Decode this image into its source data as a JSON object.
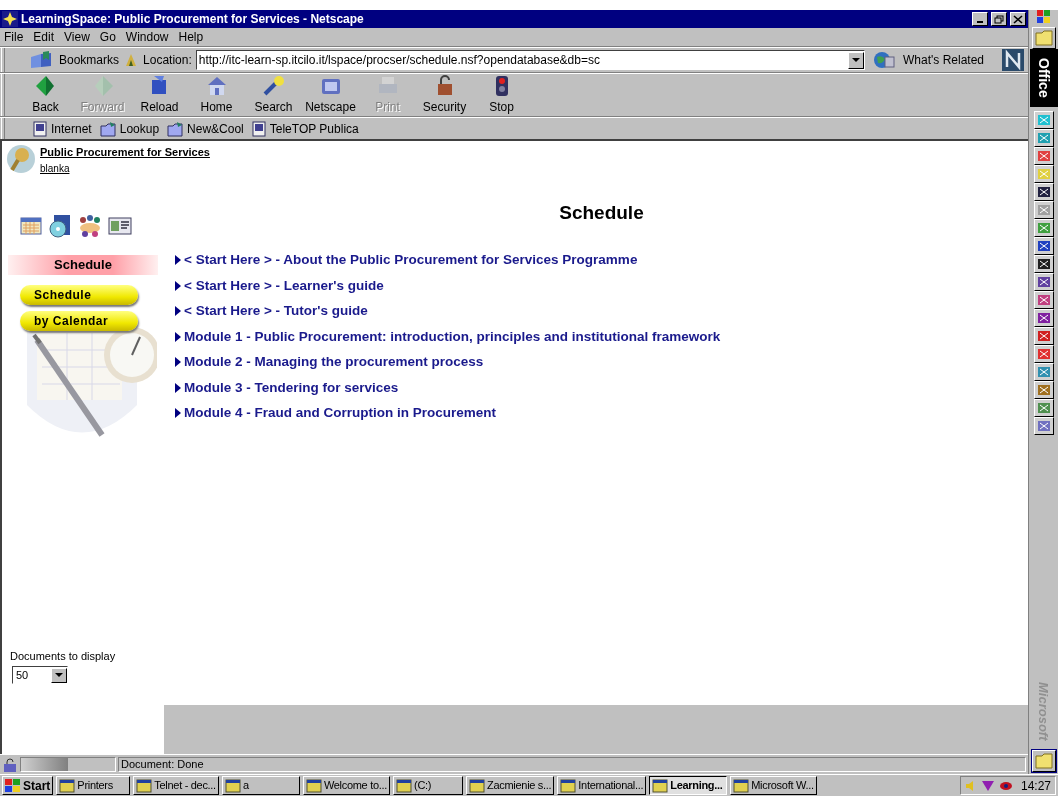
{
  "window": {
    "title": "LearningSpace: Public Procurement for Services - Netscape"
  },
  "menu": [
    "File",
    "Edit",
    "View",
    "Go",
    "Window",
    "Help"
  ],
  "location_bar": {
    "bookmarks": "Bookmarks",
    "label": "Location:",
    "url": "http://itc-learn-sp.itcilo.it/lspace/procser/schedule.nsf?opendatabase&db=sc",
    "related": "What's Related"
  },
  "toolbar": [
    {
      "label": "Back",
      "disabled": false,
      "kind": "back"
    },
    {
      "label": "Forward",
      "disabled": true,
      "kind": "forward"
    },
    {
      "label": "Reload",
      "disabled": false,
      "kind": "reload"
    },
    {
      "label": "Home",
      "disabled": false,
      "kind": "home"
    },
    {
      "label": "Search",
      "disabled": false,
      "kind": "search"
    },
    {
      "label": "Netscape",
      "disabled": false,
      "kind": "netscape"
    },
    {
      "label": "Print",
      "disabled": true,
      "kind": "print"
    },
    {
      "label": "Security",
      "disabled": false,
      "kind": "security"
    },
    {
      "label": "Stop",
      "disabled": false,
      "kind": "stop"
    }
  ],
  "personal_toolbar": [
    {
      "label": "Internet",
      "kind": "page"
    },
    {
      "label": "Lookup",
      "kind": "folder"
    },
    {
      "label": "New&Cool",
      "kind": "folder"
    },
    {
      "label": "TeleTOP Publica",
      "kind": "page"
    }
  ],
  "header": {
    "course": "Public Procurement for Services",
    "user": "blanka"
  },
  "sidebar": {
    "section": "Schedule",
    "buttons": [
      "Schedule",
      "by Calendar"
    ],
    "documents_label": "Documents to display",
    "documents_value": "50"
  },
  "main": {
    "heading": "Schedule",
    "links": [
      "< Start Here > - About the Public Procurement for Services Programme",
      "< Start Here > - Learner's guide",
      "< Start Here > - Tutor's guide",
      "Module 1 - Public Procurement: introduction, principles and institutional framework",
      "Module 2 - Managing the procurement process",
      "Module 3 - Tendering for services",
      "Module 4 - Fraud and Corruption in Procurement"
    ]
  },
  "status_bar": {
    "text": "Document: Done",
    "level": 0.5
  },
  "office_bar": {
    "title": "Office",
    "brand": "Microsoft"
  },
  "taskbar": {
    "start": "Start",
    "tasks": [
      {
        "label": "Printers",
        "selected": false
      },
      {
        "label": "Telnet - dec...",
        "selected": false
      },
      {
        "label": "a",
        "selected": false
      },
      {
        "label": "Welcome to...",
        "selected": false
      },
      {
        "label": "(C:)",
        "selected": false
      },
      {
        "label": "Zacmienie s...",
        "selected": false
      },
      {
        "label": "International...",
        "selected": false
      },
      {
        "label": "Learning...",
        "selected": true
      },
      {
        "label": "Microsoft W...",
        "selected": false
      }
    ],
    "clock": "14:27"
  }
}
